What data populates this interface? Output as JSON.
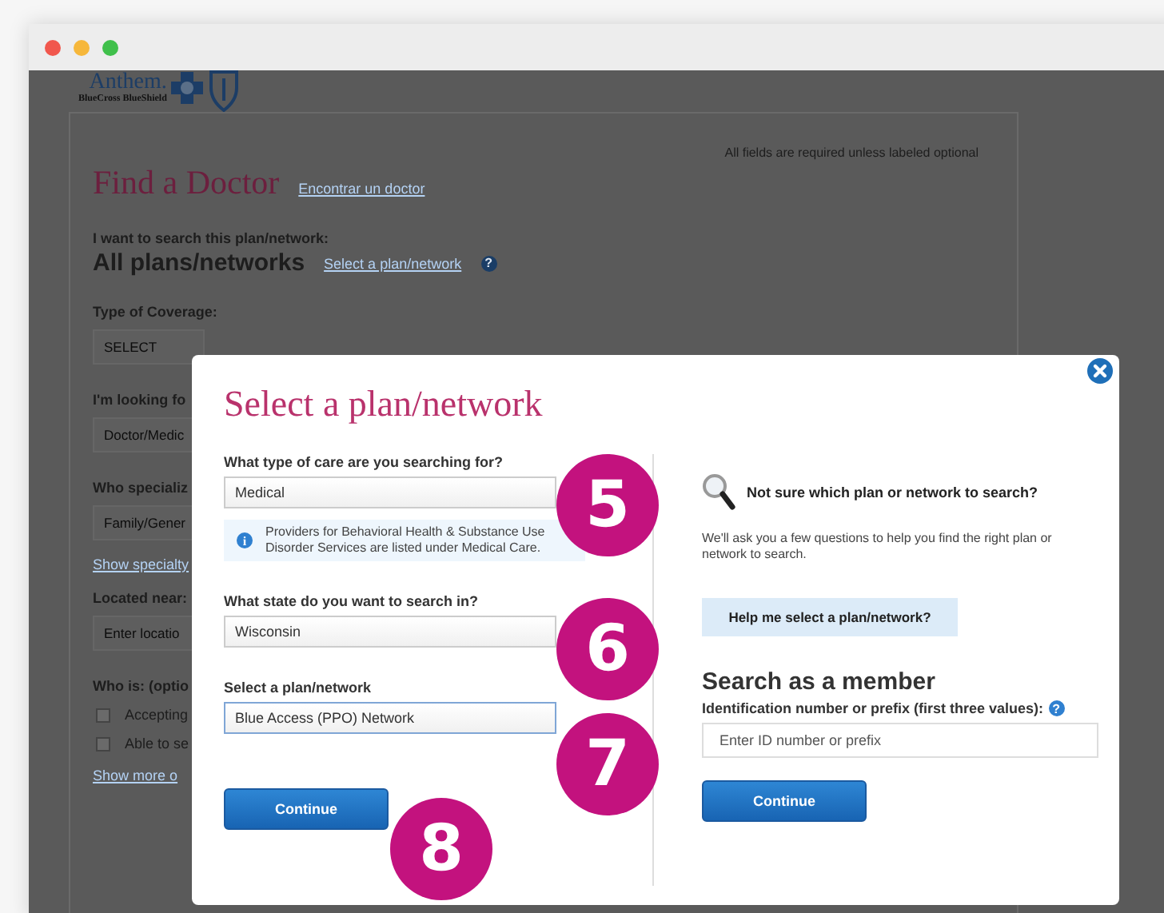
{
  "logo": {
    "name": "Anthem.",
    "tagline": "BlueCross BlueShield"
  },
  "page": {
    "required_note": "All fields are required unless labeled optional",
    "title": "Find a Doctor",
    "language_link": "Encontrar un doctor",
    "plan_label": "I want to search this plan/network:",
    "plan_value": "All plans/networks",
    "plan_link": "Select a plan/network",
    "plan_help_icon": "?",
    "fields": [
      {
        "kind": "select",
        "label": "Type of Coverage:",
        "value": "SELECT"
      },
      {
        "kind": "select",
        "label": "I'm looking fo",
        "value": "Doctor/Medic"
      },
      {
        "kind": "select",
        "label": "Who specializ",
        "value": "Family/Gener"
      },
      {
        "kind": "link",
        "label": "Show specialty"
      },
      {
        "kind": "input",
        "label": "Located near:",
        "placeholder": "Enter locatio"
      },
      {
        "kind": "checks",
        "label": "Who is: (optio",
        "options": [
          {
            "label": "Accepting",
            "checked": false
          },
          {
            "label": "Able to se",
            "checked": false
          }
        ]
      },
      {
        "kind": "link",
        "label": "Show more o"
      }
    ]
  },
  "modal": {
    "title": "Select a plan/network",
    "questions": [
      {
        "label": "What type of care are you searching for?",
        "value": "Medical",
        "focused": false,
        "note_icon": "i",
        "note": "Providers for Behavioral Health & Substance Use Disorder Services are listed under Medical Care."
      },
      {
        "label": "What state do you want to search in?",
        "value": "Wisconsin",
        "focused": false
      },
      {
        "label": "Select a plan/network",
        "value": "Blue Access (PPO) Network",
        "focused": true
      }
    ],
    "continue_button": "Continue",
    "help_heading": "Not sure which plan or network to search?",
    "help_text": "We'll ask you a few questions to help you find the right plan or network to search.",
    "help_button": "Help me select a plan/network?",
    "member_heading": "Search as a member",
    "member_label": "Identification number or prefix (first three values):",
    "member_help_icon": "?",
    "member_placeholder": "Enter ID number or prefix",
    "member_button": "Continue"
  },
  "step_badges": [
    "5",
    "6",
    "7",
    "8"
  ]
}
